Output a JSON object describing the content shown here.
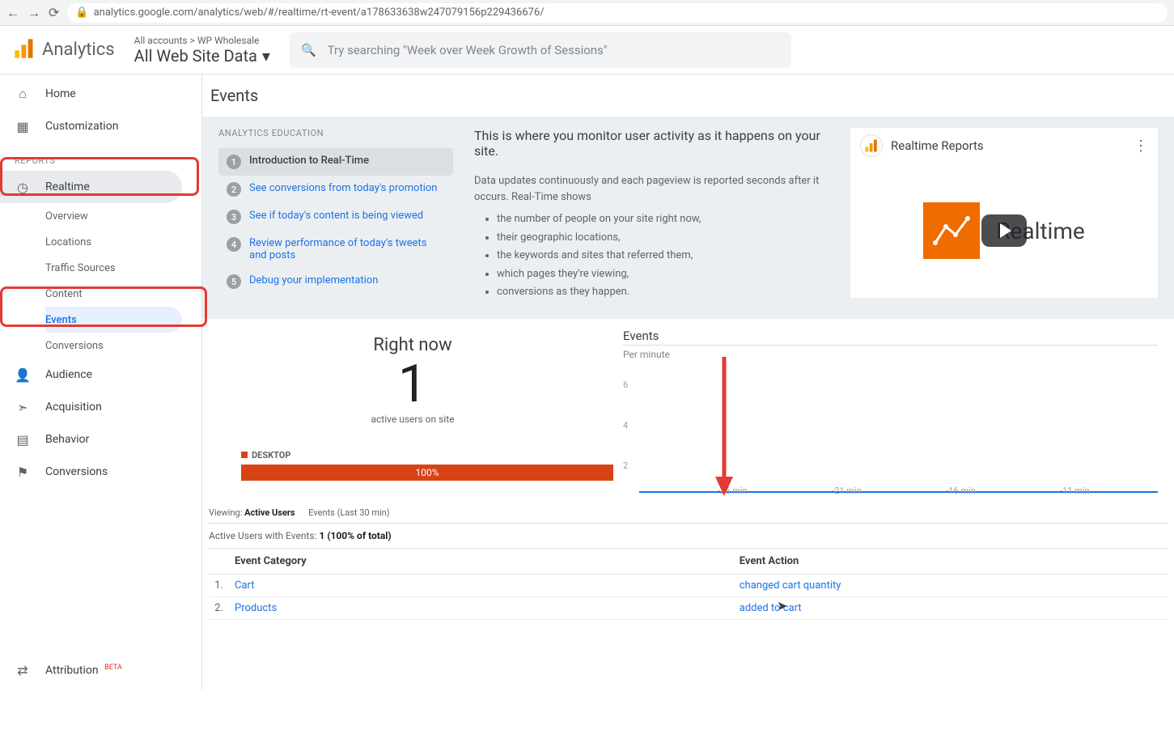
{
  "browser": {
    "url": "analytics.google.com/analytics/web/#/realtime/rt-event/a178633638w247079156p229436676/"
  },
  "header": {
    "product": "Analytics",
    "breadcrumb": "All accounts > WP Wholesale",
    "view": "All Web Site Data",
    "search_placeholder": "Try searching \"Week over Week Growth of Sessions\""
  },
  "sidebar": {
    "home": "Home",
    "customization": "Customization",
    "reports_label": "REPORTS",
    "realtime": "Realtime",
    "sub": {
      "overview": "Overview",
      "locations": "Locations",
      "traffic": "Traffic Sources",
      "content": "Content",
      "events": "Events",
      "conversions": "Conversions"
    },
    "audience": "Audience",
    "acquisition": "Acquisition",
    "behavior": "Behavior",
    "conversions": "Conversions",
    "attribution": "Attribution",
    "beta": "BETA"
  },
  "page": {
    "title": "Events"
  },
  "edu": {
    "heading": "ANALYTICS EDUCATION",
    "steps": [
      "Introduction to Real-Time",
      "See conversions from today's promotion",
      "See if today's content is being viewed",
      "Review performance of today's tweets and posts",
      "Debug your implementation"
    ],
    "headline": "This is where you monitor user activity as it happens on your site.",
    "desc": "Data updates continuously and each pageview is reported seconds after it occurs. Real-Time shows",
    "bullets": [
      "the number of people on your site right now,",
      "their geographic locations,",
      "the keywords and sites that referred them,",
      "which pages they're viewing,",
      "conversions as they happen."
    ],
    "video_title": "Realtime Reports",
    "video_overlay": "Realtime"
  },
  "realtime": {
    "rightnow": "Right now",
    "count": "1",
    "active_label": "active users on site",
    "desktop_label": "DESKTOP",
    "desktop_pct": "100%"
  },
  "events_panel": {
    "title": "Events",
    "perminute": "Per minute",
    "y_ticks": [
      "6",
      "4",
      "2"
    ],
    "x_ticks": [
      "-26 min",
      "-21 min",
      "-16 min",
      "-11 min"
    ]
  },
  "viewing": {
    "label": "Viewing:",
    "tabs": [
      "Active Users",
      "Events (Last 30 min)"
    ],
    "summary_prefix": "Active Users with Events:",
    "summary_value": "1 (100% of total)"
  },
  "table": {
    "col_category": "Event Category",
    "col_action": "Event Action",
    "rows": [
      {
        "idx": "1.",
        "category": "Cart",
        "action": "changed cart quantity"
      },
      {
        "idx": "2.",
        "category": "Products",
        "action": "added to cart"
      }
    ]
  }
}
